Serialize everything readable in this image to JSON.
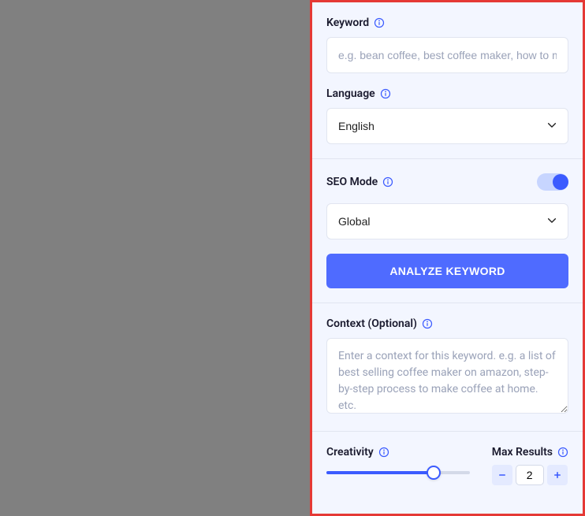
{
  "keyword": {
    "label": "Keyword",
    "placeholder": "e.g. bean coffee, best coffee maker, how to make...",
    "value": ""
  },
  "language": {
    "label": "Language",
    "value": "English"
  },
  "seo_mode": {
    "label": "SEO Mode",
    "enabled": true,
    "scope": "Global"
  },
  "analyze_button": "ANALYZE KEYWORD",
  "context": {
    "label": "Context (Optional)",
    "placeholder": "Enter a context for this keyword. e.g. a list of best selling coffee maker on amazon, step-by-step process to make coffee at home. etc.",
    "value": ""
  },
  "creativity": {
    "label": "Creativity",
    "value": 0.75
  },
  "max_results": {
    "label": "Max Results",
    "value": "2"
  }
}
